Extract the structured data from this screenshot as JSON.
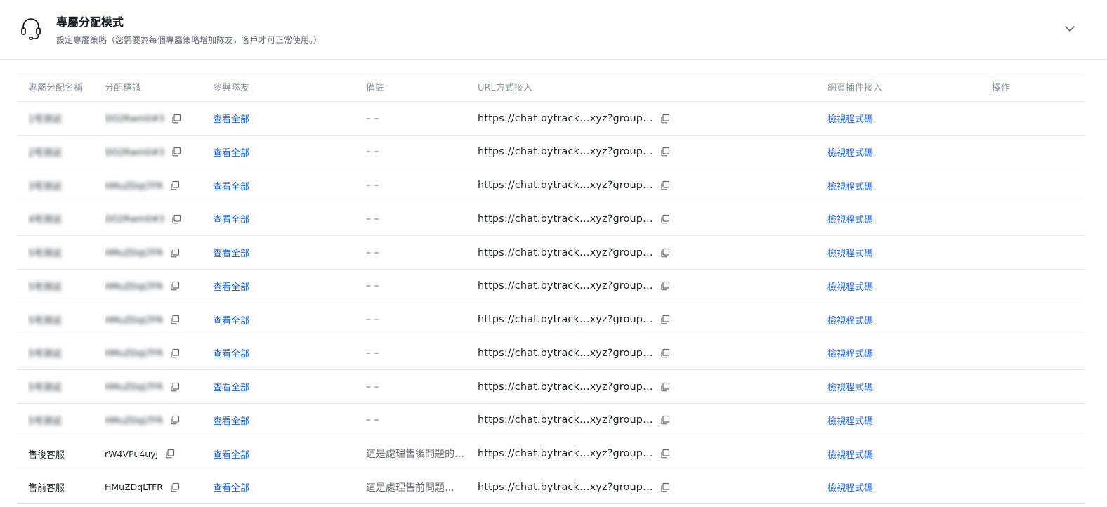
{
  "header": {
    "title": "專屬分配模式",
    "description": "設定專屬策略（您需要為每個專屬策略增加隊友，客戶才可正常使用。）",
    "icon": "headset-icon",
    "toggle_icon": "chevron-down-icon"
  },
  "table": {
    "columns": [
      "專屬分配名稱",
      "分配標識",
      "參與隊友",
      "備註",
      "URL方式接入",
      "網頁插件接入",
      "操作"
    ],
    "rows": [
      {
        "name": "1号测试",
        "id": "DO2Rwm0#3",
        "team": "查看全部",
        "note": "– –",
        "url": "https://chat.bytrack…xyz?group…",
        "embed": "檢視程式碼",
        "blurred": true
      },
      {
        "name": "2号测试",
        "id": "DO2Rwm0#3",
        "team": "查看全部",
        "note": "– –",
        "url": "https://chat.bytrack…xyz?group…",
        "embed": "檢視程式碼",
        "blurred": true
      },
      {
        "name": "3号测试",
        "id": "HMuZDqLTFR",
        "team": "查看全部",
        "note": "– –",
        "url": "https://chat.bytrack…xyz?group…",
        "embed": "檢視程式碼",
        "blurred": true
      },
      {
        "name": "4号测试",
        "id": "DO2Rwm0#3",
        "team": "查看全部",
        "note": "– –",
        "url": "https://chat.bytrack…xyz?group…",
        "embed": "檢視程式碼",
        "blurred": true
      },
      {
        "name": "5号测试",
        "id": "HMuZDqLTFR",
        "team": "查看全部",
        "note": "– –",
        "url": "https://chat.bytrack…xyz?group…",
        "embed": "檢視程式碼",
        "blurred": true
      },
      {
        "name": "5号测试",
        "id": "HMuZDqLTFR",
        "team": "查看全部",
        "note": "– –",
        "url": "https://chat.bytrack…xyz?group…",
        "embed": "檢視程式碼",
        "blurred": true
      },
      {
        "name": "5号测试",
        "id": "HMuZDqLTFR",
        "team": "查看全部",
        "note": "– –",
        "url": "https://chat.bytrack…xyz?group…",
        "embed": "檢視程式碼",
        "blurred": true
      },
      {
        "name": "5号测试",
        "id": "HMuZDqLTFR",
        "team": "查看全部",
        "note": "– –",
        "url": "https://chat.bytrack…xyz?group…",
        "embed": "檢視程式碼",
        "blurred": true
      },
      {
        "name": "5号测试",
        "id": "HMuZDqLTFR",
        "team": "查看全部",
        "note": "– –",
        "url": "https://chat.bytrack…xyz?group…",
        "embed": "檢視程式碼",
        "blurred": true
      },
      {
        "name": "5号测试",
        "id": "HMuZDqLTFR",
        "team": "查看全部",
        "note": "– –",
        "url": "https://chat.bytrack…xyz?group…",
        "embed": "檢視程式碼",
        "blurred": true
      },
      {
        "name": "售後客服",
        "id": "rW4VPu4uyJ",
        "team": "查看全部",
        "note": "這是處理售後問題的…",
        "url": "https://chat.bytrack…xyz?group…",
        "embed": "檢視程式碼",
        "blurred": false
      },
      {
        "name": "售前客服",
        "id": "HMuZDqLTFR",
        "team": "查看全部",
        "note": "這是處理售前問題…",
        "url": "https://chat.bytrack…xyz?group…",
        "embed": "檢視程式碼",
        "blurred": false
      }
    ]
  },
  "colors": {
    "link": "#1664ff",
    "header_text": "#8f959e",
    "border": "#e5e6eb"
  }
}
